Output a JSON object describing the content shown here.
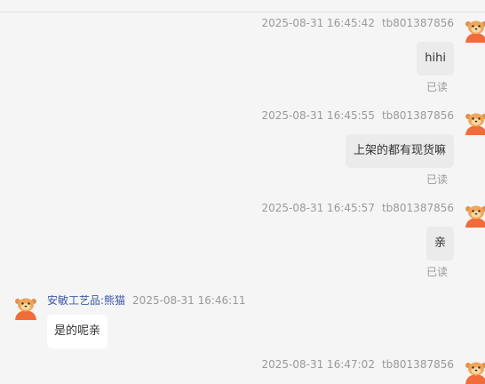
{
  "messages": [
    {
      "direction": "out",
      "time": "2025-08-31 16:45:42",
      "sender": "tb801387856",
      "text": "hihi",
      "status": "已读"
    },
    {
      "direction": "out",
      "time": "2025-08-31 16:45:55",
      "sender": "tb801387856",
      "text": "上架的都有现货嘛",
      "status": "已读"
    },
    {
      "direction": "out",
      "time": "2025-08-31 16:45:57",
      "sender": "tb801387856",
      "text": "亲",
      "status": "已读"
    },
    {
      "direction": "in",
      "time": "2025-08-31 16:46:11",
      "sender": "安敏工艺品:熊猫",
      "text": "是的呢亲"
    },
    {
      "direction": "out",
      "time": "2025-08-31 16:47:02",
      "sender": "tb801387856"
    }
  ],
  "colors": {
    "background": "#f5f5f5",
    "outgoing_bubble": "#ebebeb",
    "incoming_bubble": "#ffffff",
    "sender_name": "#3b58a8",
    "meta_text": "#9a9a9a",
    "avatar_orange": "#f26b3a"
  },
  "icons": {
    "avatar": "cartoon-avatar-icon"
  }
}
